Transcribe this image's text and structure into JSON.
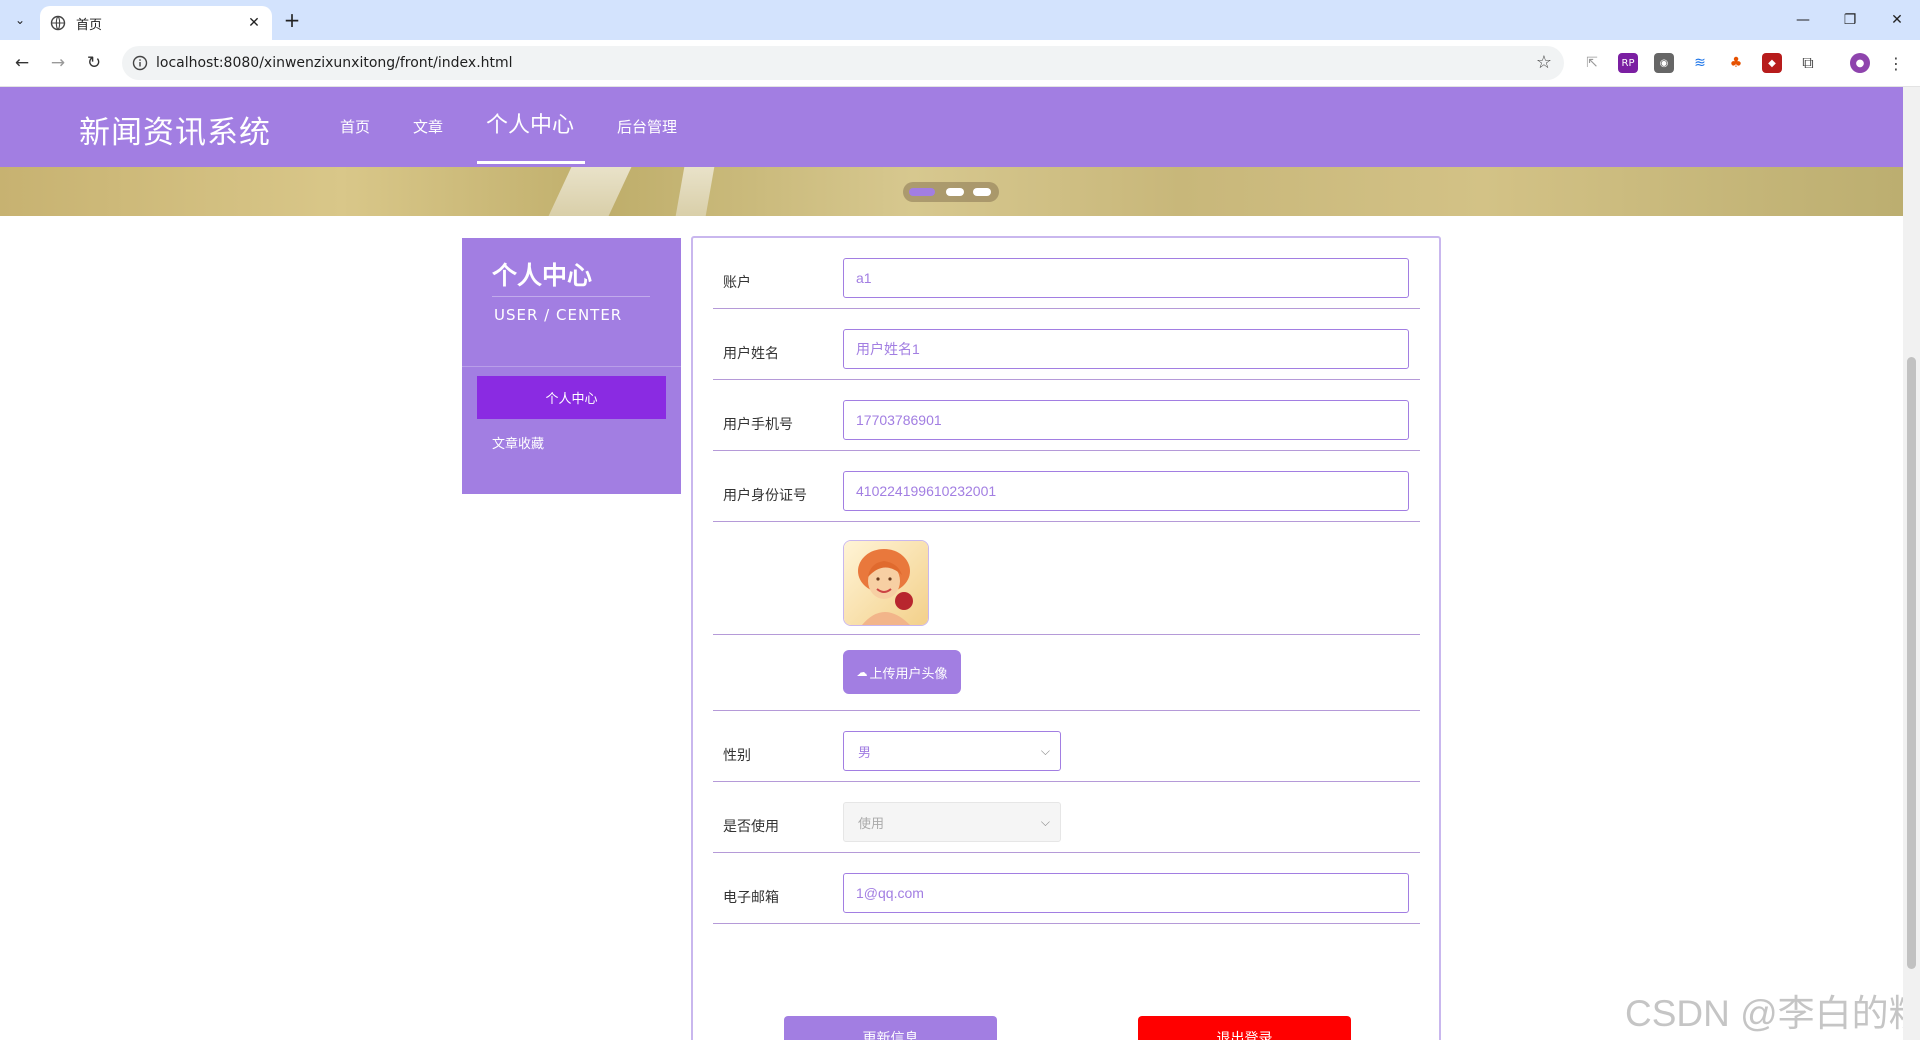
{
  "browser": {
    "tab_title": "首页",
    "url": "localhost:8080/xinwenzixunxitong/front/index.html"
  },
  "site": {
    "logo": "新闻资讯系统",
    "nav": [
      "首页",
      "文章",
      "个人中心",
      "后台管理"
    ],
    "active_nav": "个人中心"
  },
  "sidebar": {
    "title": "个人中心",
    "subtitle": "USER / CENTER",
    "items": [
      "个人中心",
      "文章收藏"
    ]
  },
  "form": {
    "account": {
      "label": "账户",
      "value": "a1"
    },
    "name": {
      "label": "用户姓名",
      "value": "用户姓名1"
    },
    "phone": {
      "label": "用户手机号",
      "value": "17703786901"
    },
    "id_card": {
      "label": "用户身份证号",
      "value": "410224199610232001"
    },
    "upload_label": "上传用户头像",
    "gender": {
      "label": "性别",
      "value": "男"
    },
    "enabled": {
      "label": "是否使用",
      "value": "使用"
    },
    "email": {
      "label": "电子邮箱",
      "value": "1@qq.com"
    },
    "update_button": "更新信息",
    "logout_button": "退出登录"
  },
  "watermark": "CSDN @李白的粉",
  "colors": {
    "primary": "#a27ee2",
    "active": "#8a2be2",
    "danger": "#ff0000"
  }
}
